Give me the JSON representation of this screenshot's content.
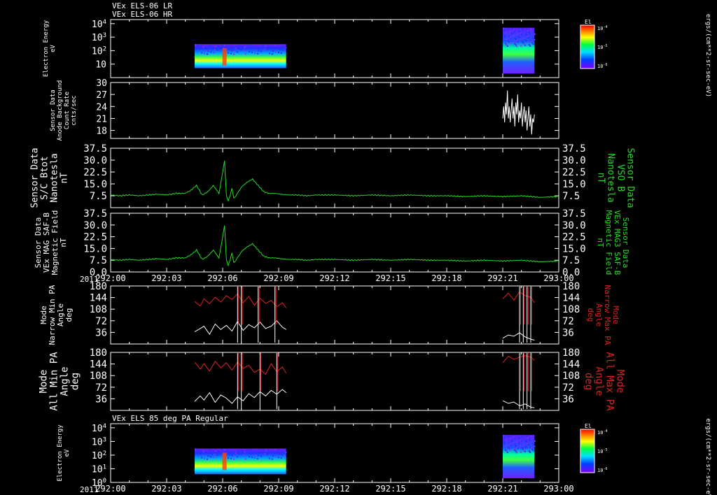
{
  "header": {
    "line1": "VEx ELS-06 LR",
    "line2": "VEx ELS-06 HR"
  },
  "x_ticks": [
    "292:00",
    "292:03",
    "292:06",
    "292:09",
    "292:12",
    "292:15",
    "292:18",
    "292:21",
    "293:00"
  ],
  "year_label": "2011",
  "colors": {
    "background": "#000000",
    "axes": "#ffffff",
    "green": "#22dd22",
    "red": "#dd2222",
    "white": "#ffffff"
  },
  "chart_data": [
    {
      "type": "heatmap",
      "panel": "els-spectrogram-top",
      "ylabel": [
        "Electron Energy",
        "eV"
      ],
      "yscale": "log",
      "ylim": [
        1,
        20000
      ],
      "yticks": [
        {
          "base": "10",
          "exp": "4",
          "v": 10000
        },
        {
          "base": "10",
          "exp": "3",
          "v": 1000
        },
        {
          "base": "10",
          "exp": "2",
          "v": 100
        },
        {
          "base": "10",
          "exp": "",
          "v": 10
        }
      ],
      "colorbar": {
        "title": "El",
        "ticks": [
          {
            "base": "10",
            "exp": "-4"
          },
          {
            "base": "10",
            "exp": "-5"
          },
          {
            "base": "10",
            "exp": "-6"
          }
        ],
        "unit": "ergs/(cm**2-sr-sec-eV)"
      },
      "blocks": [
        {
          "x0": 4.5,
          "x1": 9.4,
          "ymin": 5,
          "ymax": 300,
          "note": "LR"
        },
        {
          "x0": 21.0,
          "x1": 22.7,
          "ymin": 2,
          "ymax": 5000,
          "note": "HR"
        }
      ]
    },
    {
      "type": "line",
      "panel": "anode-background",
      "ylabel": [
        "Sensor Data",
        "Anode Background",
        "Count Rate",
        "cnts/sec"
      ],
      "ylim": [
        16,
        30
      ],
      "yticks": [
        30,
        27,
        24,
        21,
        18
      ],
      "series": [
        {
          "color": "white",
          "x": [
            21.0,
            21.05,
            21.1,
            21.15,
            21.2,
            21.25,
            21.3,
            21.35,
            21.4,
            21.45,
            21.5,
            21.55,
            21.6,
            21.65,
            21.7,
            21.75,
            21.8,
            21.85,
            21.9,
            21.95,
            22.0,
            22.05,
            22.1,
            22.15,
            22.2,
            22.25,
            22.3,
            22.35,
            22.4,
            22.45,
            22.5,
            22.55,
            22.6,
            22.65,
            22.7
          ],
          "y": [
            21,
            24,
            20,
            25,
            22,
            28,
            21,
            24,
            20,
            23,
            26,
            21,
            24,
            19,
            25,
            22,
            27,
            20,
            23,
            21,
            25,
            19,
            22,
            24,
            20,
            23,
            18,
            21,
            24,
            19,
            22,
            17,
            21,
            20,
            22
          ]
        }
      ]
    },
    {
      "type": "line",
      "panel": "sc-btot",
      "ylabel": [
        "Sensor Data",
        "S/C Btot",
        "Nanotesla",
        "nT"
      ],
      "ylabel_right": [
        "Sensor Data",
        "VSO B",
        "Nanotesla",
        "nT"
      ],
      "ylim": [
        0,
        37.5
      ],
      "yticks": [
        "37.5",
        "30.0",
        "22.5",
        "15.0",
        "7.5"
      ],
      "series": [
        {
          "color": "green",
          "x": [
            0,
            0.5,
            1,
            1.5,
            2,
            2.5,
            3,
            3.5,
            4,
            4.3,
            4.6,
            4.9,
            5.2,
            5.5,
            5.8,
            6.0,
            6.1,
            6.2,
            6.3,
            6.4,
            6.5,
            6.6,
            6.8,
            7.0,
            7.3,
            7.6,
            7.9,
            8.2,
            8.5,
            8.8,
            9.1,
            9.5,
            10,
            10.5,
            11,
            12,
            13,
            14,
            15,
            16,
            17,
            18,
            19,
            20,
            21,
            22,
            23,
            24
          ],
          "y": [
            8,
            7.5,
            8,
            7.5,
            8,
            8.5,
            8,
            9,
            9,
            11,
            14,
            8,
            10,
            14,
            9,
            22,
            30,
            8,
            4,
            8,
            12,
            6,
            9,
            13,
            16,
            18,
            14,
            10,
            9,
            9,
            8.5,
            8,
            8,
            7.5,
            8,
            8,
            7.5,
            8,
            7.5,
            8,
            7.5,
            7.5,
            7,
            7.5,
            7,
            7.5,
            6.5,
            7
          ]
        }
      ]
    },
    {
      "type": "line",
      "panel": "mag-b",
      "ylabel": [
        "Sensor Data",
        "VEx MAG SAF-B",
        "Magnetic Field",
        "nT"
      ],
      "ylabel_right": [
        "Sensor Data",
        "VEx MAG3 SAF-B",
        "Magnetic Field",
        "nT"
      ],
      "ylim": [
        0,
        37.5
      ],
      "yticks": [
        "37.5",
        "30.0",
        "22.5",
        "15.0",
        "7.5",
        "0.0"
      ],
      "series": [
        {
          "color": "green",
          "x": [
            0,
            0.5,
            1,
            1.5,
            2,
            2.5,
            3,
            3.5,
            4,
            4.3,
            4.6,
            4.9,
            5.2,
            5.5,
            5.8,
            6.0,
            6.1,
            6.2,
            6.3,
            6.4,
            6.5,
            6.6,
            6.8,
            7.0,
            7.3,
            7.6,
            7.9,
            8.2,
            8.5,
            8.8,
            9.1,
            9.5,
            10,
            10.5,
            11,
            12,
            13,
            14,
            15,
            16,
            17,
            18,
            19,
            20,
            21,
            22,
            23,
            24
          ],
          "y": [
            8,
            7.5,
            8,
            7.5,
            8,
            8.5,
            8,
            9,
            9,
            11,
            14,
            8,
            10,
            14,
            9,
            22,
            30,
            8,
            4,
            8,
            12,
            6,
            9,
            13,
            16,
            18,
            14,
            10,
            9,
            9,
            8.5,
            8,
            8,
            7.5,
            8,
            8,
            7.5,
            8,
            7.5,
            8,
            7.5,
            7.5,
            7,
            7.5,
            7,
            7.5,
            6.5,
            7
          ]
        }
      ]
    },
    {
      "type": "line",
      "panel": "narrow-pa",
      "ylabel": [
        "Mode",
        "Narrow Min PA",
        "Angle",
        "deg"
      ],
      "ylabel_right": [
        "Mode",
        "Narrow Max PA",
        "Angle",
        "deg"
      ],
      "ylim": [
        0,
        180
      ],
      "yticks": [
        180,
        144,
        108,
        72,
        36
      ],
      "series": [
        {
          "name": "Narrow Max PA",
          "color": "red",
          "x": [
            4.5,
            4.8,
            5.0,
            5.3,
            5.6,
            5.9,
            6.2,
            6.5,
            6.8,
            7.1,
            7.4,
            7.7,
            8.0,
            8.3,
            8.6,
            8.9,
            9.2,
            9.4,
            21.0,
            21.3,
            21.6,
            21.9,
            22.2,
            22.5,
            22.7
          ],
          "y": [
            132,
            118,
            140,
            125,
            145,
            130,
            150,
            138,
            155,
            128,
            148,
            120,
            142,
            126,
            135,
            115,
            128,
            112,
            140,
            158,
            136,
            162,
            150,
            145,
            128
          ]
        },
        {
          "name": "Narrow Min PA",
          "color": "white",
          "x": [
            4.5,
            4.8,
            5.0,
            5.3,
            5.6,
            5.9,
            6.2,
            6.5,
            6.8,
            7.1,
            7.4,
            7.7,
            8.0,
            8.3,
            8.6,
            8.9,
            9.2,
            9.4,
            21.0,
            21.3,
            21.6,
            21.9,
            22.2,
            22.5,
            22.7
          ],
          "y": [
            38,
            48,
            55,
            30,
            62,
            45,
            58,
            40,
            70,
            42,
            60,
            50,
            68,
            48,
            55,
            72,
            52,
            45,
            18,
            28,
            24,
            35,
            22,
            15,
            12
          ]
        }
      ],
      "spikes": [
        6.8,
        7.0,
        7.9,
        8.8,
        21.9,
        22.1,
        22.3,
        22.5
      ]
    },
    {
      "type": "line",
      "panel": "all-pa",
      "ylabel": [
        "Mode",
        "All Min PA",
        "Angle",
        "deg"
      ],
      "ylabel_right": [
        "Mode",
        "All Max PA",
        "Angle",
        "deg"
      ],
      "ylim": [
        0,
        180
      ],
      "yticks": [
        180,
        144,
        108,
        72,
        36
      ],
      "series": [
        {
          "name": "All Max PA",
          "color": "red",
          "x": [
            4.5,
            4.8,
            5.0,
            5.3,
            5.6,
            5.9,
            6.2,
            6.5,
            6.8,
            7.1,
            7.4,
            7.7,
            8.0,
            8.3,
            8.6,
            8.9,
            9.2,
            9.4,
            21.0,
            21.3,
            21.6,
            21.9,
            22.2,
            22.5,
            22.7
          ],
          "y": [
            150,
            128,
            145,
            122,
            152,
            132,
            148,
            125,
            150,
            130,
            140,
            118,
            128,
            112,
            145,
            120,
            135,
            115,
            148,
            168,
            158,
            165,
            170,
            165,
            155
          ]
        },
        {
          "name": "All Min PA",
          "color": "white",
          "x": [
            4.5,
            4.8,
            5.0,
            5.3,
            5.6,
            5.9,
            6.2,
            6.5,
            6.8,
            7.1,
            7.4,
            7.7,
            8.0,
            8.3,
            8.6,
            8.9,
            9.2,
            9.4,
            21.0,
            21.3,
            21.6,
            21.9,
            22.2,
            22.5,
            22.7
          ],
          "y": [
            28,
            45,
            32,
            55,
            25,
            48,
            38,
            22,
            42,
            30,
            52,
            40,
            58,
            45,
            62,
            50,
            65,
            55,
            30,
            22,
            26,
            14,
            20,
            10,
            8
          ]
        }
      ],
      "spikes": [
        6.8,
        7.0,
        8.0,
        8.9,
        21.9,
        22.1,
        22.3,
        22.5
      ]
    },
    {
      "type": "heatmap",
      "panel": "els-85deg",
      "title": "VEx ELS 85 deg PA Regular",
      "ylabel": [
        "Electron Energy",
        "eV"
      ],
      "yscale": "log",
      "ylim": [
        1,
        20000
      ],
      "yticks": [
        {
          "base": "10",
          "exp": "4",
          "v": 10000
        },
        {
          "base": "10",
          "exp": "3",
          "v": 1000
        },
        {
          "base": "10",
          "exp": "2",
          "v": 100
        },
        {
          "base": "10",
          "exp": "1",
          "v": 10
        },
        {
          "base": "10",
          "exp": "0",
          "v": 1
        }
      ],
      "colorbar": {
        "title": "El",
        "ticks": [
          {
            "base": "10",
            "exp": "-4"
          },
          {
            "base": "10",
            "exp": "-5"
          },
          {
            "base": "10",
            "exp": "-6"
          }
        ],
        "unit": "ergs/(cm**2-sr-sec-eV)"
      },
      "blocks": [
        {
          "x0": 4.5,
          "x1": 9.4,
          "ymin": 4,
          "ymax": 300
        },
        {
          "x0": 21.0,
          "x1": 22.7,
          "ymin": 2,
          "ymax": 3000
        }
      ]
    }
  ]
}
